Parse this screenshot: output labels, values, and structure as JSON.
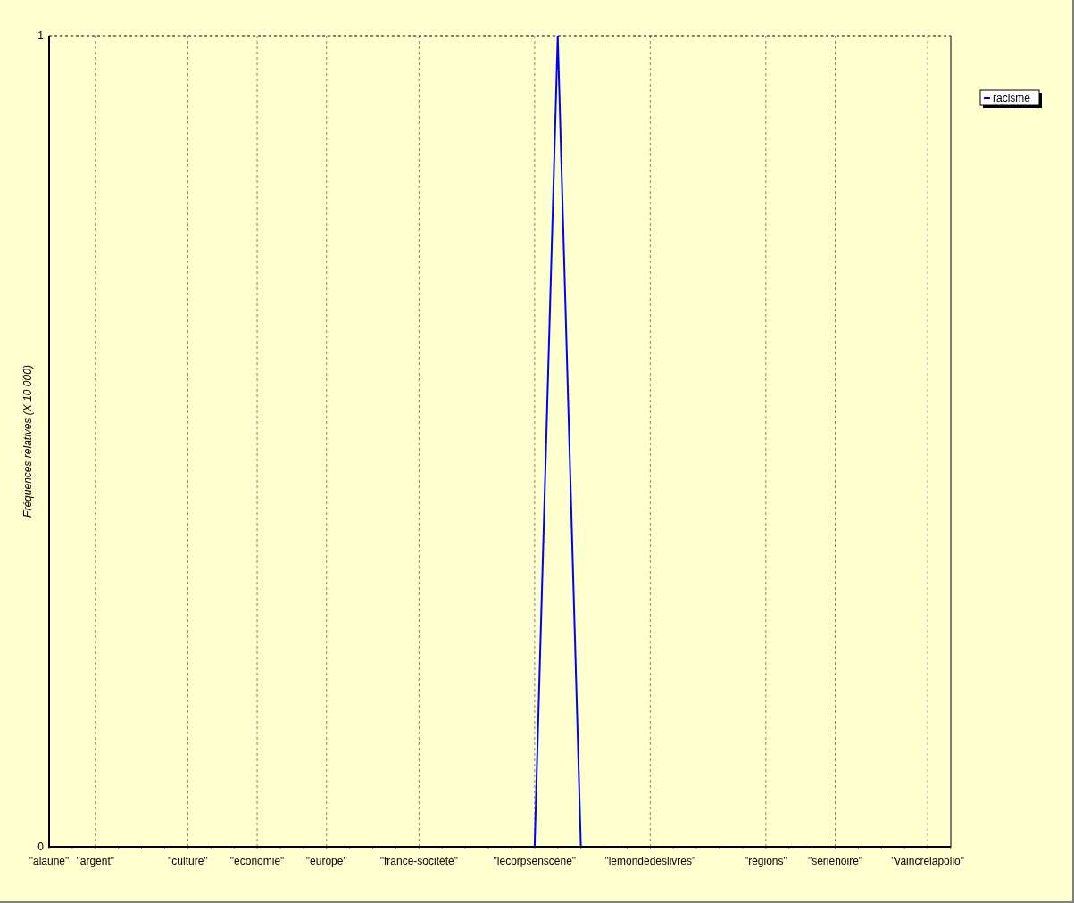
{
  "chart_data": {
    "type": "line",
    "ylabel": "Fréquences relatives (X 10 000)",
    "categories": [
      "\"alaune\"",
      null,
      "\"argent\"",
      null,
      null,
      null,
      "\"culture\"",
      null,
      null,
      "\"economie\"",
      null,
      null,
      "\"europe\"",
      null,
      null,
      null,
      "\"france-socitété\"",
      null,
      null,
      null,
      null,
      "\"lecorpsenscène\"",
      null,
      null,
      null,
      null,
      "\"lemondedeslivres\"",
      null,
      null,
      null,
      null,
      "\"régions\"",
      null,
      null,
      "\"sérienoire\"",
      null,
      null,
      null,
      "\"vaincrelapolio\"",
      null
    ],
    "series": [
      {
        "name": "racisme",
        "color": "#0000ff",
        "values": [
          null,
          null,
          null,
          null,
          null,
          null,
          null,
          null,
          null,
          null,
          null,
          null,
          null,
          null,
          null,
          null,
          null,
          null,
          null,
          null,
          null,
          0,
          1,
          0,
          null,
          null,
          null,
          null,
          null,
          null,
          null,
          null,
          null,
          null,
          null,
          null,
          null,
          null,
          null,
          null
        ]
      }
    ],
    "ylim": [
      0,
      1
    ],
    "yticks": [
      0,
      1
    ],
    "grid": true
  }
}
